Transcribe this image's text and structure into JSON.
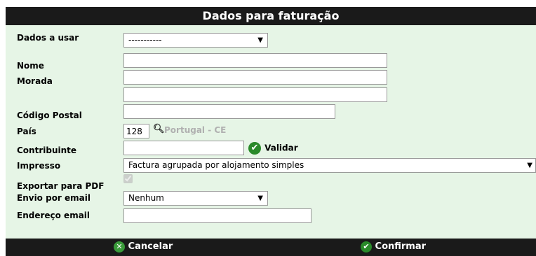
{
  "dialog": {
    "title": "Dados para faturação"
  },
  "form": {
    "dados_a_usar": {
      "label": "Dados a usar",
      "value": "-----------"
    },
    "nome": {
      "label": "Nome",
      "value": ""
    },
    "morada": {
      "label": "Morada",
      "value_1": "",
      "value_2": ""
    },
    "codigo_postal": {
      "label": "Código Postal",
      "value": ""
    },
    "pais": {
      "label": "País",
      "code": "128",
      "name": "Portugal - CE"
    },
    "contribuinte": {
      "label": "Contribuinte",
      "value": "",
      "validate_label": "Validar"
    },
    "impresso": {
      "label": "Impresso",
      "value": "Factura agrupada por alojamento simples"
    },
    "exportar_pdf": {
      "label": "Exportar para PDF",
      "checked": true
    },
    "envio_email": {
      "label": "Envio por email",
      "value": "Nenhum"
    },
    "endereco_email": {
      "label": "Endereço email",
      "value": ""
    }
  },
  "footer": {
    "cancel_label": "Cancelar",
    "confirm_label": "Confirmar"
  },
  "colors": {
    "panel_bg": "#e6f5e6",
    "titlebar_bg": "#1a1a1a",
    "accent_green": "#2a8a2a"
  }
}
